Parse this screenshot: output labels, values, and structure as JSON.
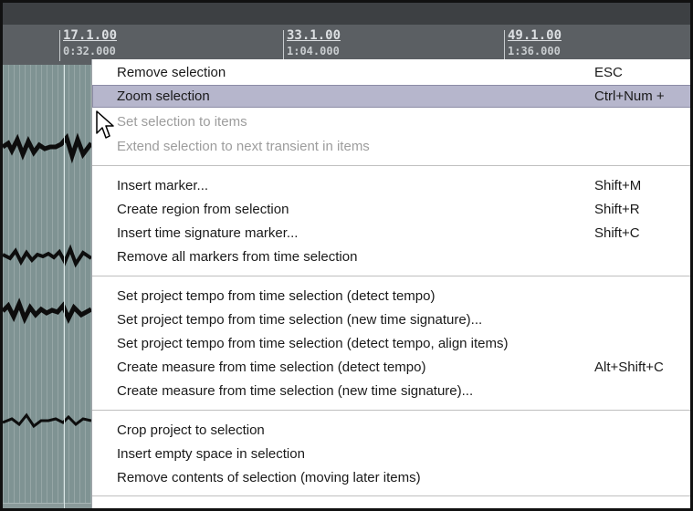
{
  "ruler": {
    "markers": [
      {
        "bar": "17.1.00",
        "time": "0:32.000"
      },
      {
        "bar": "33.1.00",
        "time": "1:04.000"
      },
      {
        "bar": "49.1.00",
        "time": "1:36.000"
      }
    ]
  },
  "menu": {
    "groups": [
      [
        {
          "label": "Remove selection",
          "shortcut": "ESC",
          "enabled": true,
          "highlighted": false
        },
        {
          "label": "Zoom selection",
          "shortcut": "Ctrl+Num +",
          "enabled": true,
          "highlighted": true
        },
        {
          "label": "Set selection to items",
          "shortcut": "",
          "enabled": false,
          "highlighted": false
        },
        {
          "label": "Extend selection to next transient in items",
          "shortcut": "",
          "enabled": false,
          "highlighted": false
        }
      ],
      [
        {
          "label": "Insert marker...",
          "shortcut": "Shift+M",
          "enabled": true
        },
        {
          "label": "Create region from selection",
          "shortcut": "Shift+R",
          "enabled": true
        },
        {
          "label": "Insert time signature marker...",
          "shortcut": "Shift+C",
          "enabled": true
        },
        {
          "label": "Remove all markers from time selection",
          "shortcut": "",
          "enabled": true
        }
      ],
      [
        {
          "label": "Set project tempo from time selection (detect tempo)",
          "shortcut": "",
          "enabled": true
        },
        {
          "label": "Set project tempo from time selection (new time signature)...",
          "shortcut": "",
          "enabled": true
        },
        {
          "label": "Set project tempo from time selection (detect tempo, align items)",
          "shortcut": "",
          "enabled": true
        },
        {
          "label": "Create measure from time selection (detect tempo)",
          "shortcut": "Alt+Shift+C",
          "enabled": true
        },
        {
          "label": "Create measure from time selection (new time signature)...",
          "shortcut": "",
          "enabled": true
        }
      ],
      [
        {
          "label": "Crop project to selection",
          "shortcut": "",
          "enabled": true
        },
        {
          "label": "Insert empty space in selection",
          "shortcut": "",
          "enabled": true
        },
        {
          "label": "Remove contents of selection (moving later items)",
          "shortcut": "",
          "enabled": true
        }
      ]
    ]
  },
  "colors": {
    "highlight": "#b6b6cc",
    "disabled_text": "#9d9d9d",
    "ruler_bg": "#5b5f63",
    "track_bg": "#7f9393"
  }
}
